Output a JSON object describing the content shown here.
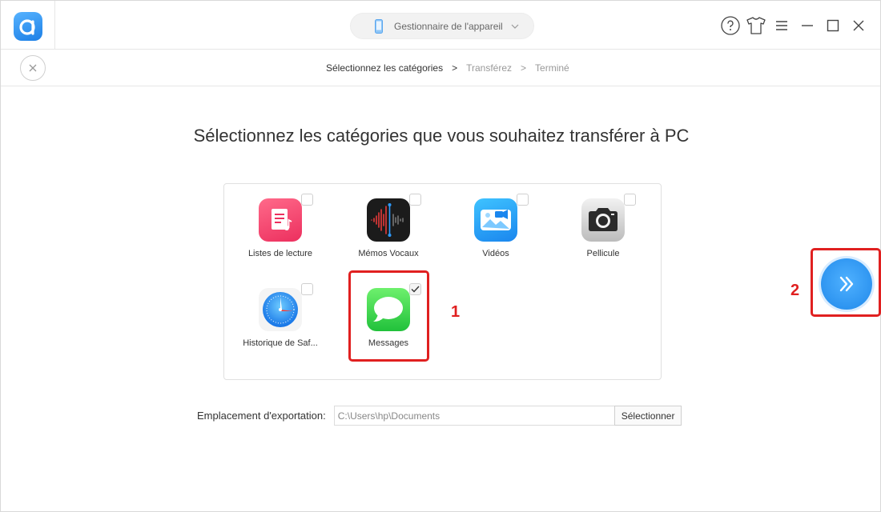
{
  "header": {
    "device_label": "Gestionnaire de l'appareil"
  },
  "steps": [
    "Sélectionnez les catégories",
    ">",
    "Transférez",
    ">",
    "Terminé"
  ],
  "heading": "Sélectionnez les catégories que vous souhaitez transférer à PC",
  "categories": [
    {
      "label": "Listes de lecture",
      "checked": false,
      "icon": "playlist-icon",
      "color": "#f0486e"
    },
    {
      "label": "Mémos Vocaux",
      "checked": false,
      "icon": "voice-memo-icon",
      "color": "#1a1a1a"
    },
    {
      "label": "Vidéos",
      "checked": false,
      "icon": "videos-icon",
      "color": "#1e9bf0"
    },
    {
      "label": "Pellicule",
      "checked": false,
      "icon": "camera-icon",
      "color": "#d9d9d9"
    },
    {
      "label": "Historique de Saf...",
      "checked": false,
      "icon": "safari-icon",
      "color": "#1a8cf0"
    },
    {
      "label": "Messages",
      "checked": true,
      "icon": "messages-icon",
      "color": "#34c84a"
    }
  ],
  "annotations": {
    "one": "1",
    "two": "2"
  },
  "export": {
    "label": "Emplacement d'exportation:",
    "path": "C:\\Users\\hp\\Documents",
    "button": "Sélectionner"
  },
  "colors": {
    "accent": "#1f88ea",
    "highlight": "#e02020"
  }
}
